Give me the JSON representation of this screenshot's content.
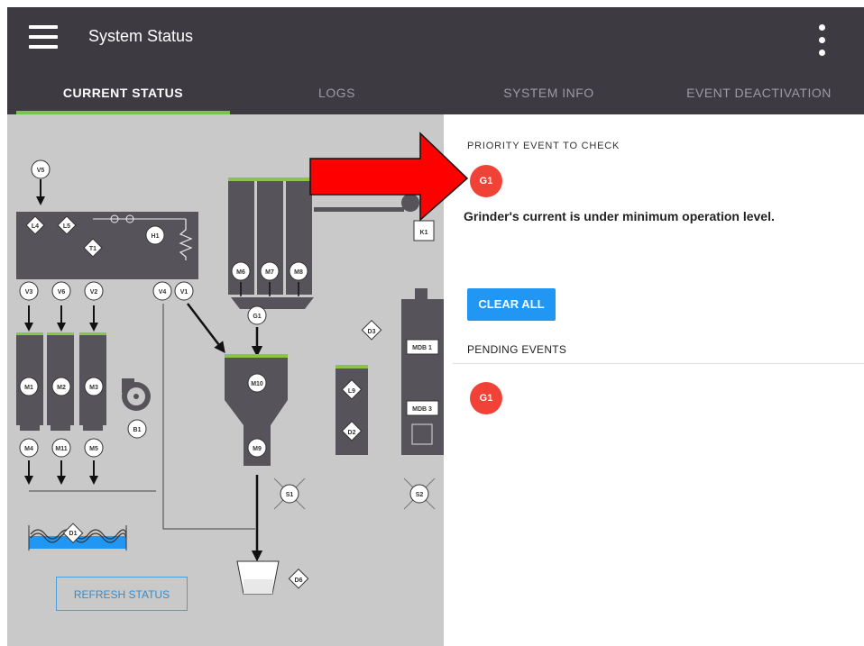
{
  "app": {
    "title": "System Status"
  },
  "tabs": [
    {
      "label": "CURRENT STATUS",
      "active": true
    },
    {
      "label": "LOGS",
      "active": false
    },
    {
      "label": "SYSTEM INFO",
      "active": false
    },
    {
      "label": "EVENT DEACTIVATION",
      "active": false
    }
  ],
  "diagram": {
    "components": [
      "V5",
      "L4",
      "L5",
      "H1",
      "T1",
      "V3",
      "V6",
      "V2",
      "V4",
      "V1",
      "M1",
      "M2",
      "M3",
      "B1",
      "M4",
      "M11",
      "M5",
      "M6",
      "M7",
      "M8",
      "G1",
      "K1",
      "D3",
      "M10",
      "M9",
      "L9",
      "D2",
      "MDB 1",
      "MDB 3",
      "S1",
      "S2",
      "D1",
      "D6"
    ],
    "refresh_label": "REFRESH STATUS"
  },
  "priority": {
    "label": "PRIORITY EVENT TO CHECK",
    "badge": "G1",
    "message": "Grinder's current is under minimum operation level."
  },
  "actions": {
    "clear_all": "CLEAR ALL"
  },
  "pending": {
    "label": "PENDING EVENTS",
    "events": [
      {
        "badge": "G1"
      }
    ]
  },
  "colors": {
    "appbar": "#3d3a42",
    "tab_indicator": "#7cc153",
    "event_badge": "#f04236",
    "button": "#2196f3",
    "diagram_bg": "#c9c9c9",
    "machine_fill": "#5a575c",
    "level_green": "#8bc34a",
    "annotation_arrow": "#ff0000"
  }
}
